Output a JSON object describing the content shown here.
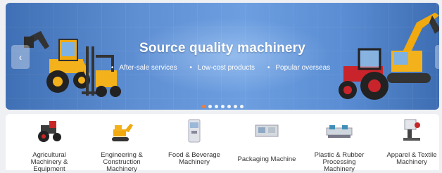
{
  "banner": {
    "title": "Source quality machinery",
    "subtitles": [
      "After-sale services",
      "Low-cost products",
      "Popular overseas"
    ],
    "prev_icon": "chevron-left-icon",
    "next_icon": "chevron-right-icon",
    "slide_count": 7,
    "active_slide": 1,
    "colors": {
      "accent": "#ff7a2a",
      "banner_blue": "#5f8fd3"
    }
  },
  "categories": [
    {
      "label": "Agricultural Machinery & Equipment",
      "icon": "tractor-icon"
    },
    {
      "label": "Engineering & Construction Machinery",
      "icon": "excavator-icon"
    },
    {
      "label": "Food & Beverage Machinery",
      "icon": "ice-cream-machine-icon"
    },
    {
      "label": "Packaging Machine",
      "icon": "packaging-machine-icon"
    },
    {
      "label": "Plastic & Rubber Processing Machinery",
      "icon": "injection-molding-machine-icon"
    },
    {
      "label": "Apparel & Textile Machinery",
      "icon": "sewing-machine-icon"
    }
  ]
}
